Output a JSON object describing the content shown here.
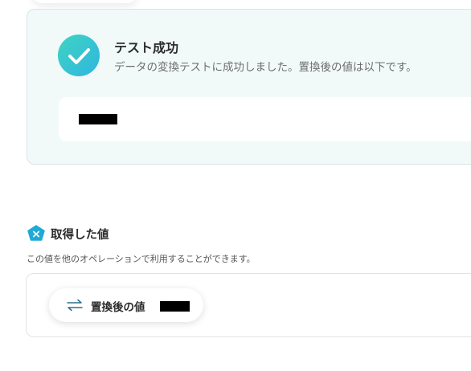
{
  "success": {
    "title": "テスト成功",
    "description": "データの変換テストに成功しました。置換後の値は以下です。"
  },
  "section": {
    "title": "取得した値",
    "description": "この値を他のオペレーションで利用することができます。"
  },
  "values": {
    "chip_label": "置換後の値"
  },
  "colors": {
    "accent_gradient_start": "#3fd4c2",
    "accent_gradient_end": "#2fb6e0",
    "section_icon": "#1fa9d6",
    "card_bg": "#f2f9f9"
  }
}
